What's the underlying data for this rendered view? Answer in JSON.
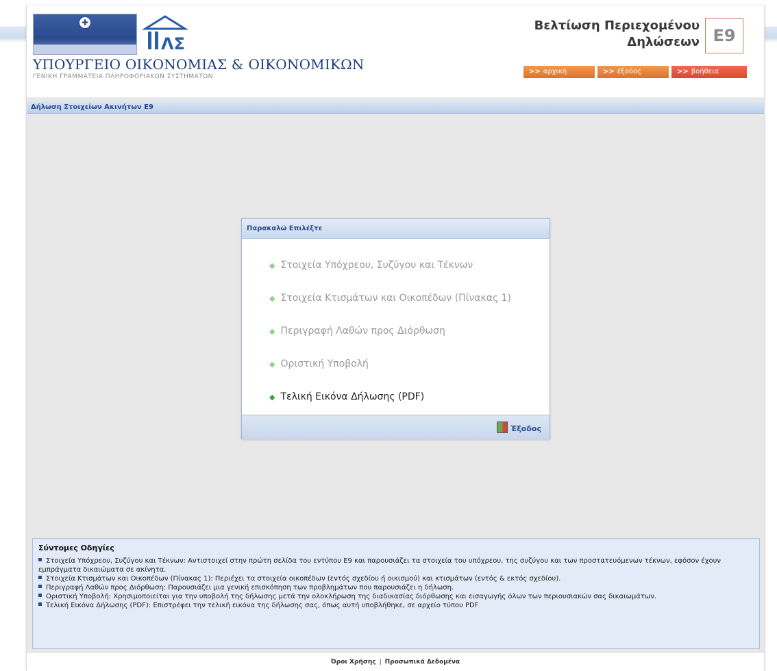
{
  "header": {
    "ministry_title": "ΥΠΟΥΡΓΕΙΟ ΟΙΚΟΝΟΜΙΑΣ & ΟΙΚΟΝΟΜΙΚΩΝ",
    "ministry_subtitle": "ΓΕΝΙΚΗ ΓΡΑΜΜΑΤΕΙΑ ΠΛΗΡΟΦΟΡΙΑΚΩΝ ΣΥΣΤΗΜΑΤΩΝ",
    "app_title_line1": "Βελτίωση Περιεχομένου",
    "app_title_line2": "Δηλώσεων",
    "badge": "E9"
  },
  "nav": {
    "home": "αρχική",
    "logout": "έξοδος",
    "help": "βοήθεια",
    "arrow": ">>"
  },
  "section_title": "Δήλωση Στοιχείων Ακινήτων E9",
  "panel": {
    "title": "Παρακαλώ Επιλέξτε",
    "items": [
      {
        "label": "Στοιχεία Υπόχρεου, Συζύγου και Τέκνων",
        "enabled": false
      },
      {
        "label": "Στοιχεία Κτισμάτων και Οικοπέδων (Πίνακας 1)",
        "enabled": false
      },
      {
        "label": "Περιγραφή Λαθών προς Διόρθωση",
        "enabled": false
      },
      {
        "label": "Οριστική Υποβολή",
        "enabled": false
      },
      {
        "label": "Τελική Εικόνα Δήλωσης (PDF)",
        "enabled": true
      }
    ],
    "exit_label": "Έξοδος"
  },
  "instructions": {
    "title": "Σύντομες Οδηγίες",
    "items": [
      "Στοιχεία Υπόχρεου, Συζύγου και Τέκνων: Αντιστοιχεί στην πρώτη σελίδα του εντύπου E9 και παρουσιάζει τα στοιχεία του υπόχρεου, της συζύγου και των προστατευόμενων τέκνων, εφόσον έχουν εμπράγματα δικαιώματα σε ακίνητα.",
      "Στοιχεία Κτισμάτων και Οικοπέδων (Πίνακας 1): Περιέχει τα στοιχεία οικοπέδων (εντός σχεδίου ή οικισμού) και κτισμάτων (εντός & εκτός σχεδίου).",
      "Περιγραφή Λαθών προς Διόρθωση: Παρουσιάζει μια γενική επισκόπηση των προβλημάτων που παρουσιάζει η δήλωση.",
      "Οριστική Υποβολή: Χρησιμοποιείται για την υποβολή της δήλωσης μετά την ολοκλήρωση της διαδικασίας διόρθωσης και εισαγωγής όλων των περιουσιακών σας δικαιωμάτων.",
      "Τελική Εικόνα Δήλωσης (PDF): Επιστρέφει την τελική εικόνα της δήλωσης σας, όπως αυτή υποβλήθηκε, σε αρχείο τύπου PDF"
    ]
  },
  "footer": {
    "terms": "Όροι Χρήσης",
    "separator": "|",
    "privacy": "Προσωπικά Δεδομένα"
  }
}
